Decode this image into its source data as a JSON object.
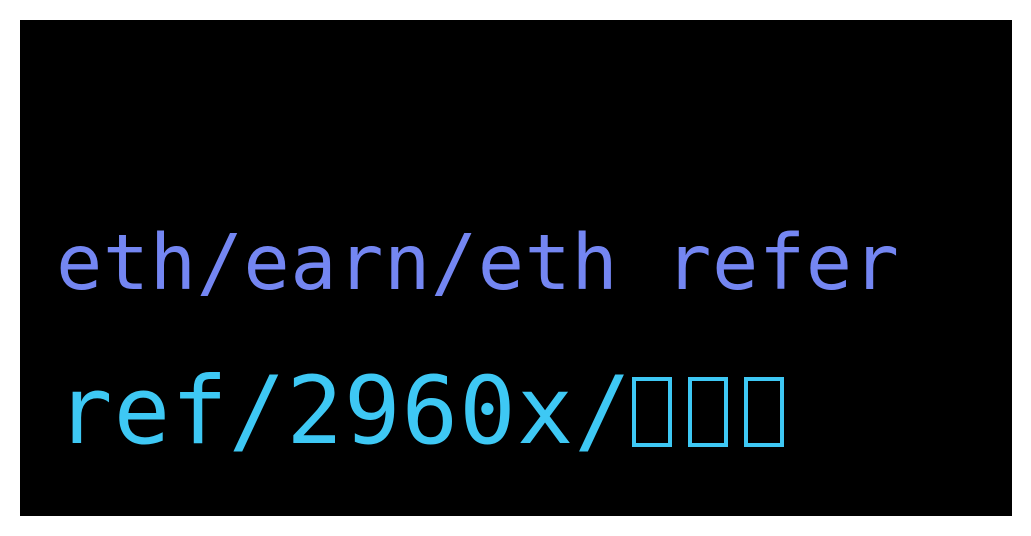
{
  "lines": {
    "line1": {
      "text": "eth/earn/eth refer",
      "color": "#7486f2"
    },
    "line2": {
      "text": "ref/2960x/",
      "unrendered_glyph_count": 3,
      "color": "#3ec8f4"
    }
  },
  "colors": {
    "background": "#000000",
    "border": "#ffffff"
  }
}
